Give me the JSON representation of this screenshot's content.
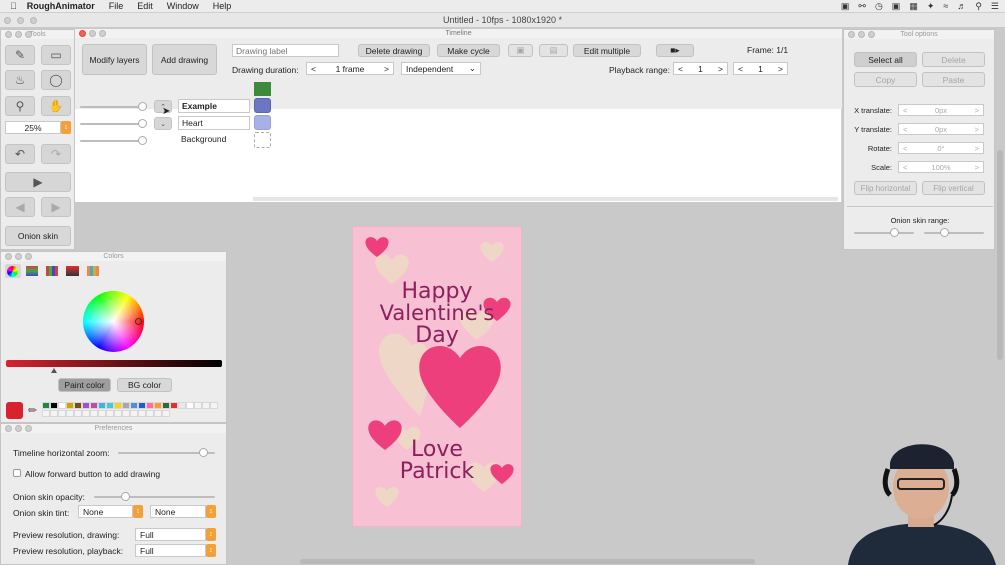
{
  "menubar": {
    "app_name": "RoughAnimator",
    "items": [
      "File",
      "Edit",
      "Window",
      "Help"
    ]
  },
  "window": {
    "title": "Untitled - 10fps - 1080x1920 *"
  },
  "tools_panel": {
    "title": "Tools",
    "zoom_value": "25%",
    "onion_skin_label": "Onion skin"
  },
  "timeline_panel": {
    "title": "Timeline",
    "modify_layers_label": "Modify layers",
    "add_drawing_label": "Add drawing",
    "drawing_label_placeholder": "Drawing label",
    "delete_drawing_label": "Delete drawing",
    "make_cycle_label": "Make cycle",
    "edit_multiple_label": "Edit multiple",
    "frame_label": "Frame: 1/1",
    "drawing_duration_label": "Drawing duration:",
    "drawing_duration_value": "1 frame",
    "duration_mode": "Independent",
    "playback_range_label": "Playback range:",
    "playback_start": "1",
    "playback_end": "1",
    "layers": [
      {
        "name": "Example",
        "color": "#6b77c4"
      },
      {
        "name": "Heart",
        "color": "#a8b0e4"
      },
      {
        "name": "Background",
        "color": ""
      }
    ]
  },
  "colors_panel": {
    "title": "Colors",
    "paint_color_label": "Paint color",
    "bg_color_label": "BG color",
    "current_color": "#d8232f",
    "swatches": [
      "#1b8a3c",
      "#000000",
      "#ffffff",
      "#d4a300",
      "#7a4d1c",
      "#a050c8",
      "#c04aa8",
      "#3bb3e8",
      "#48c8d6",
      "#f2d31f",
      "#a8a8a8",
      "#4d8fd8",
      "#1e5fd0",
      "#ff6f9a",
      "#ff9a2e",
      "#2e6b3a",
      "#e03030",
      "#e8e8e8",
      "#ffffff"
    ]
  },
  "preferences_panel": {
    "title": "Preferences",
    "timeline_zoom_label": "Timeline horizontal zoom:",
    "allow_forward_label": "Allow forward button to add drawing",
    "onion_opacity_label": "Onion skin opacity:",
    "onion_tint_label": "Onion skin tint:",
    "onion_tint_1": "None",
    "onion_tint_2": "None",
    "preview_drawing_label": "Preview resolution, drawing:",
    "preview_drawing_value": "Full",
    "preview_playback_label": "Preview resolution, playback:",
    "preview_playback_value": "Full"
  },
  "tool_options": {
    "title": "Tool options",
    "select_all_label": "Select all",
    "delete_label": "Delete",
    "copy_label": "Copy",
    "paste_label": "Paste",
    "x_translate_label": "X translate:",
    "x_translate_value": "0px",
    "y_translate_label": "Y translate:",
    "y_translate_value": "0px",
    "rotate_label": "Rotate:",
    "rotate_value": "0°",
    "scale_label": "Scale:",
    "scale_value": "100%",
    "flip_h_label": "Flip horizontal",
    "flip_v_label": "Flip vertical",
    "onion_range_label": "Onion skin range:"
  },
  "canvas": {
    "line1": "Happy",
    "line2": "Valentine's",
    "line3": "Day",
    "line4": "Love",
    "line5": "Patrick"
  }
}
